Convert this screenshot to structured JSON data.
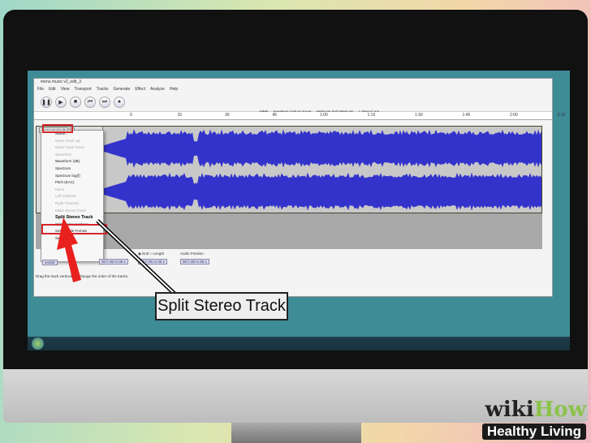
{
  "window": {
    "title": "menu music v2_edit_3"
  },
  "menubar": [
    "File",
    "Edit",
    "View",
    "Transport",
    "Tracks",
    "Generate",
    "Effect",
    "Analyze",
    "Help"
  ],
  "transport": [
    {
      "icon": "pause-icon",
      "glyph": "❚❚"
    },
    {
      "icon": "play-icon",
      "glyph": "▶"
    },
    {
      "icon": "stop-icon",
      "glyph": "■"
    },
    {
      "icon": "skip-start-icon",
      "glyph": "⏮"
    },
    {
      "icon": "skip-end-icon",
      "glyph": "⏭"
    },
    {
      "icon": "record-icon",
      "glyph": "●"
    }
  ],
  "devices": {
    "host": "MME",
    "output": "Speakers (ASUS Xonar",
    "input": "Webcam (HD Webcam",
    "channels": "1 (Mono) Inp"
  },
  "meter_labels": [
    "-24",
    "0",
    "-24",
    "0"
  ],
  "ruler": [
    "0",
    "15",
    "30",
    "45",
    "1:00",
    "1:15",
    "1:30",
    "1:45",
    "2:00",
    "2:15"
  ],
  "track": {
    "name": "menu music",
    "scale": "1.0"
  },
  "context_menu": [
    {
      "label": "Name...",
      "disabled": false
    },
    {
      "label": "Move Track Up",
      "disabled": true
    },
    {
      "label": "Move Track Down",
      "disabled": true
    },
    {
      "label": "Waveform",
      "disabled": true
    },
    {
      "label": "Waveform (dB)",
      "disabled": false
    },
    {
      "label": "Spectrum",
      "disabled": false
    },
    {
      "label": "Spectrum log(f)",
      "disabled": false
    },
    {
      "label": "Pitch (EAC)",
      "disabled": false
    },
    {
      "label": "Mono",
      "disabled": true
    },
    {
      "label": "Left Channel",
      "disabled": true
    },
    {
      "label": "Right Channel",
      "disabled": true
    },
    {
      "label": "Make Stereo Track",
      "disabled": true
    },
    {
      "label": "Split Stereo Track",
      "disabled": false,
      "highlight": true
    },
    {
      "label": "Split Stereo to Mono",
      "disabled": false
    },
    {
      "label": "Set Sample Format",
      "disabled": false
    },
    {
      "label": "Set Rate",
      "disabled": false
    }
  ],
  "selection": {
    "project_rate": "44100",
    "end_label": "End",
    "length_label": "Length",
    "audio_position_label": "Audio Position",
    "timecode": "00 h 00 m 00 s"
  },
  "status": "Drag the track vertically to change the order of the tracks.",
  "callout": "Split Stereo Track",
  "colors": {
    "wave": "#3333cc",
    "highlight": "#d3272b",
    "screen": "#3d8c96"
  },
  "branding": {
    "logo": "wikiHow",
    "badge": "Healthy Living"
  }
}
